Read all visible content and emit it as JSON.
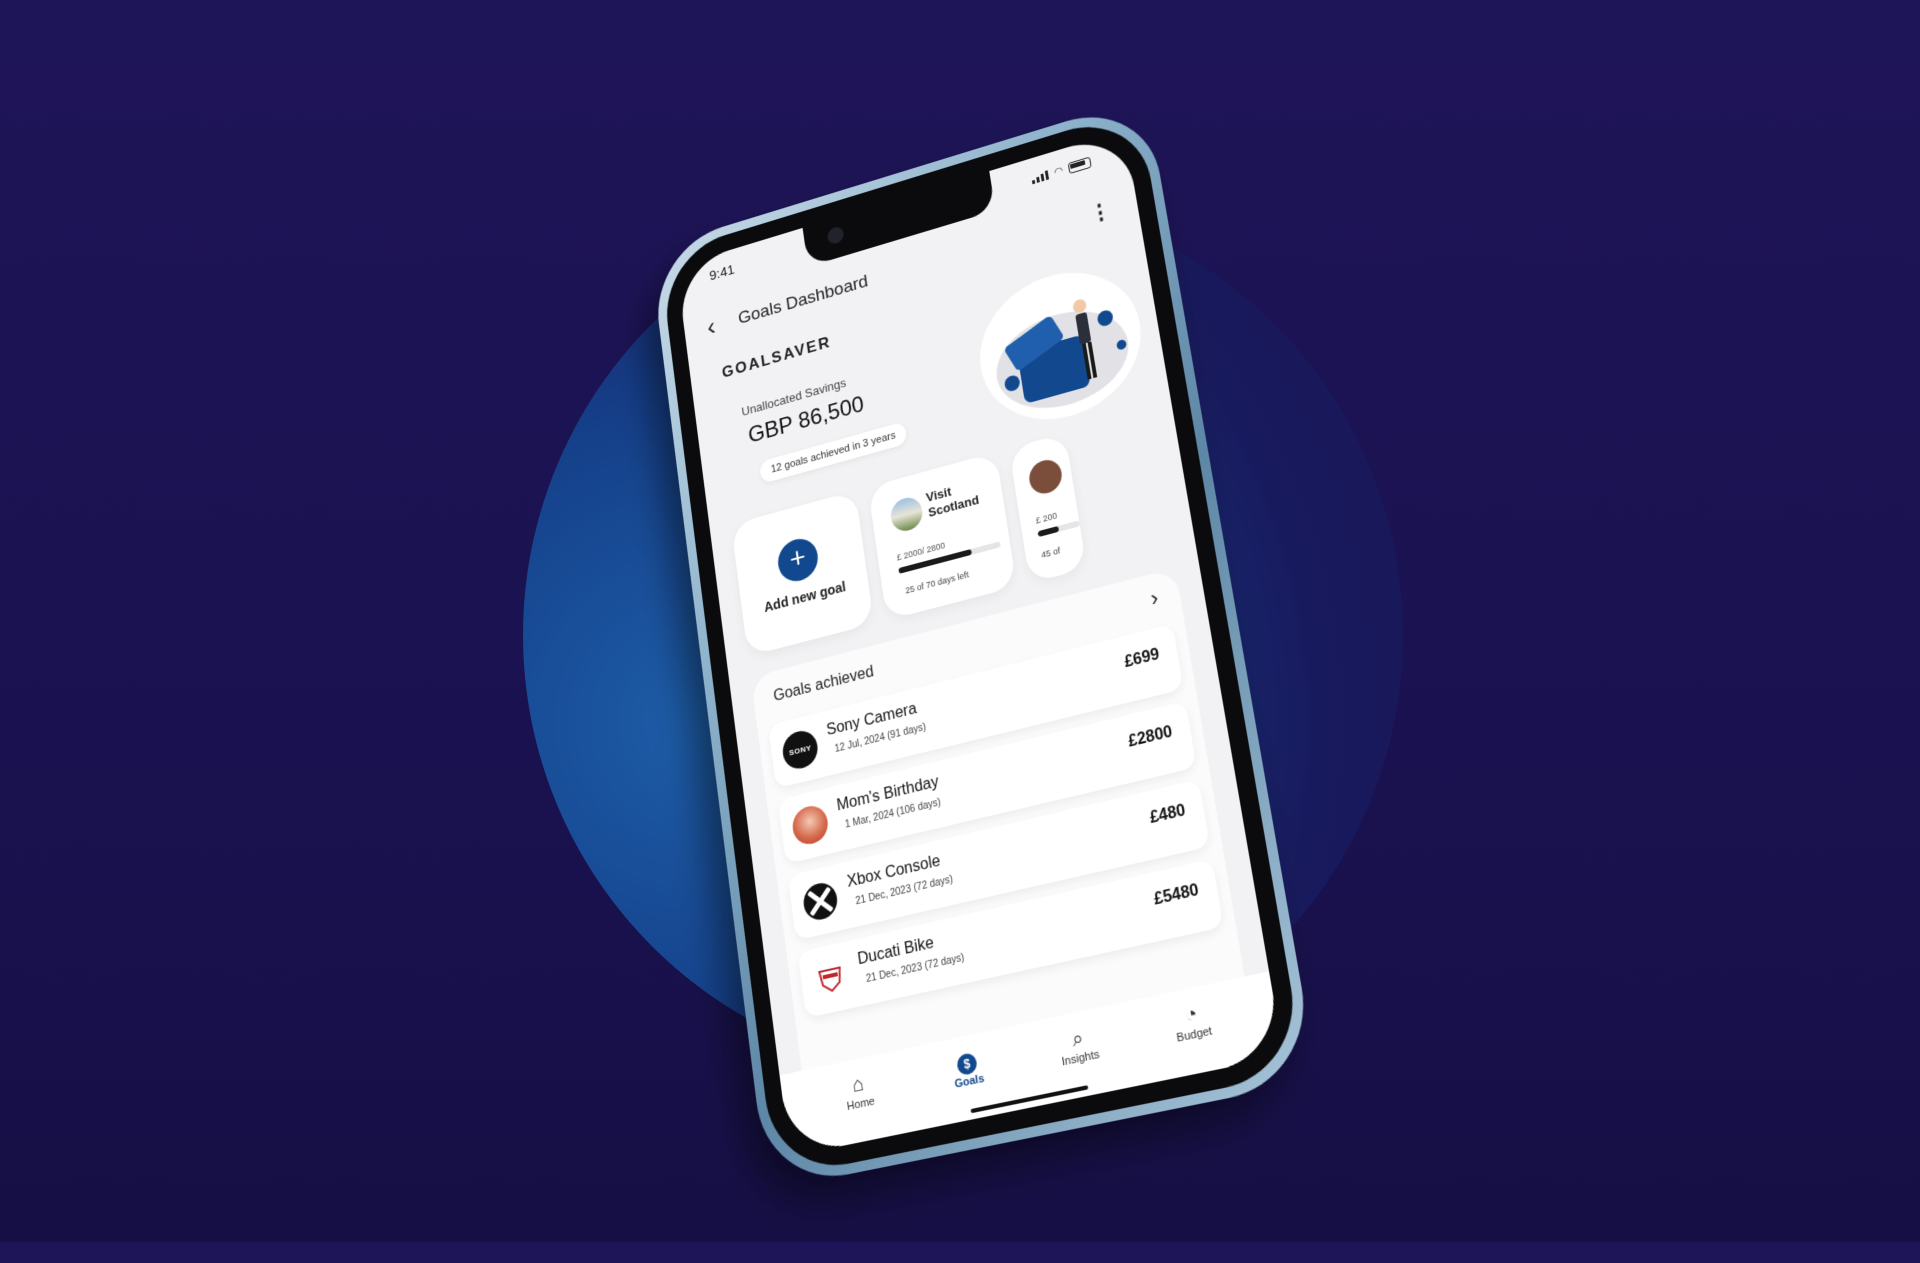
{
  "status": {
    "time": "9:41"
  },
  "appbar": {
    "title": "Goals Dashboard"
  },
  "brand": "GOALSAVER",
  "hero": {
    "label": "Unallocated Savings",
    "amount": "GBP 86,500",
    "chip": "12 goals achieved in 3 years"
  },
  "cards": {
    "add_label": "Add new goal",
    "goals": [
      {
        "name": "Visit Scotland",
        "amount": "£ 2000/ 2800",
        "progress": 0.714,
        "days": "25 of 70 days left"
      },
      {
        "name": "",
        "amount": "£ 200",
        "progress": 0.5,
        "days": "45 of"
      }
    ]
  },
  "achieved": {
    "title": "Goals achieved",
    "items": [
      {
        "logo": "SONY",
        "title": "Sony Camera",
        "sub": "12 Jul, 2024 (91 days)",
        "amount": "£699"
      },
      {
        "logo": "",
        "title": "Mom's Birthday",
        "sub": "1 Mar, 2024 (106 days)",
        "amount": "£2800"
      },
      {
        "logo": "",
        "title": "Xbox Console",
        "sub": "21 Dec, 2023 (72 days)",
        "amount": "£480"
      },
      {
        "logo": "",
        "title": "Ducati Bike",
        "sub": "21 Dec, 2023 (72 days)",
        "amount": "£5480"
      }
    ]
  },
  "tabs": [
    {
      "label": "Home",
      "icon": "home-icon"
    },
    {
      "label": "Goals",
      "icon": "goals-icon"
    },
    {
      "label": "Insights",
      "icon": "insights-icon"
    },
    {
      "label": "Budget",
      "icon": "budget-icon"
    }
  ],
  "colors": {
    "accent": "#12488e",
    "background": "#1e1458"
  }
}
